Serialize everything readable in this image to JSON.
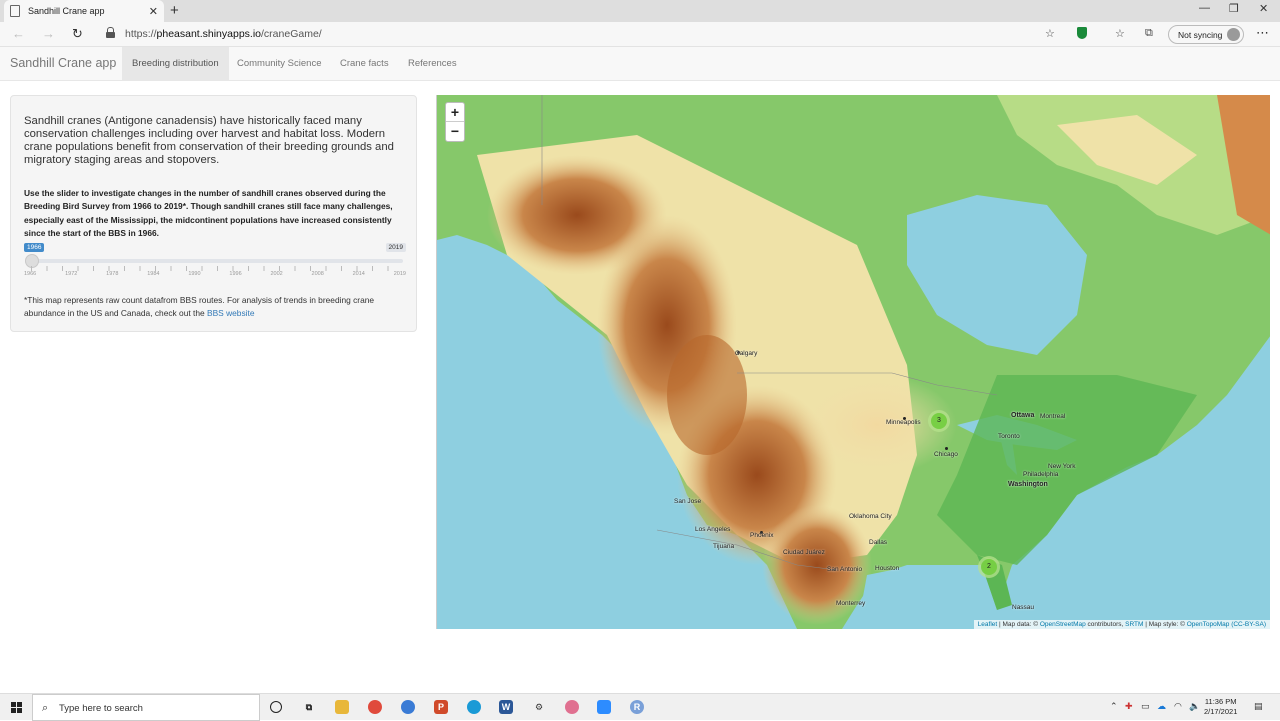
{
  "browser": {
    "tab_title": "Sandhill Crane app",
    "url_scheme": "https://",
    "url_host": "pheasant.shinyapps.io",
    "url_path": "/craneGame/",
    "sync_label": "Not syncing"
  },
  "app": {
    "brand": "Sandhill Crane app",
    "tabs": [
      {
        "label": "Breeding distribution",
        "active": true
      },
      {
        "label": "Community Science",
        "active": false
      },
      {
        "label": "Crane facts",
        "active": false
      },
      {
        "label": "References",
        "active": false
      }
    ]
  },
  "sidebar": {
    "intro": "Sandhill cranes (Antigone canadensis) have historically faced many conservation challenges including over harvest and habitat loss. Modern crane populations benefit from conservation of their breeding grounds and migratory staging areas and stopovers.",
    "instructions": "Use the slider to investigate changes in the number of sandhill cranes observed during the Breeding Bird Survey from 1966 to 2019*. Though sandhill cranes still face many challenges, especially east of the Mississippi, the midcontinent populations have increased consistently since the start of the BBS in 1966.",
    "slider": {
      "min_label": "1966",
      "max_label": "2019",
      "value": 1966,
      "min": 1966,
      "max": 2019,
      "tick_labels": [
        "1966",
        "1972",
        "1978",
        "1984",
        "1990",
        "1996",
        "2002",
        "2008",
        "2014",
        "2019"
      ]
    },
    "note_text": "*This map represents raw count datafrom BBS routes. For analysis of trends in breeding crane abundance in the US and Canada, check out the",
    "note_link": "BBS website"
  },
  "map": {
    "zoom_in": "+",
    "zoom_out": "−",
    "cities": [
      {
        "name": "Calgary",
        "big": false
      },
      {
        "name": "Minneapolis",
        "big": false
      },
      {
        "name": "Ottawa",
        "big": true
      },
      {
        "name": "Montreal",
        "big": false
      },
      {
        "name": "Toronto",
        "big": false
      },
      {
        "name": "Chicago",
        "big": false
      },
      {
        "name": "New York",
        "big": false
      },
      {
        "name": "Philadelphia",
        "big": false
      },
      {
        "name": "Washington",
        "big": true
      },
      {
        "name": "San Jose",
        "big": false
      },
      {
        "name": "Los Angeles",
        "big": false
      },
      {
        "name": "Tijuana",
        "big": false
      },
      {
        "name": "Phoenix",
        "big": false
      },
      {
        "name": "Ciudad Juárez",
        "big": false
      },
      {
        "name": "San Antonio",
        "big": false
      },
      {
        "name": "Houston",
        "big": false
      },
      {
        "name": "Dallas",
        "big": false
      },
      {
        "name": "Oklahoma City",
        "big": false
      },
      {
        "name": "Monterrey",
        "big": false
      },
      {
        "name": "Nassau",
        "big": false
      }
    ],
    "clusters": [
      {
        "count": "3"
      },
      {
        "count": "2"
      }
    ],
    "attribution": {
      "leaflet": "Leaflet",
      "text1": " | Map data: © ",
      "osm": "OpenStreetMap",
      "text2": " contributors, ",
      "srtm": "SRTM",
      "text3": " | Map style: © ",
      "otm": "OpenTopoMap (CC-BY-SA)"
    }
  },
  "taskbar": {
    "search_placeholder": "Type here to search",
    "time": "11:36 PM",
    "date": "2/17/2021"
  }
}
